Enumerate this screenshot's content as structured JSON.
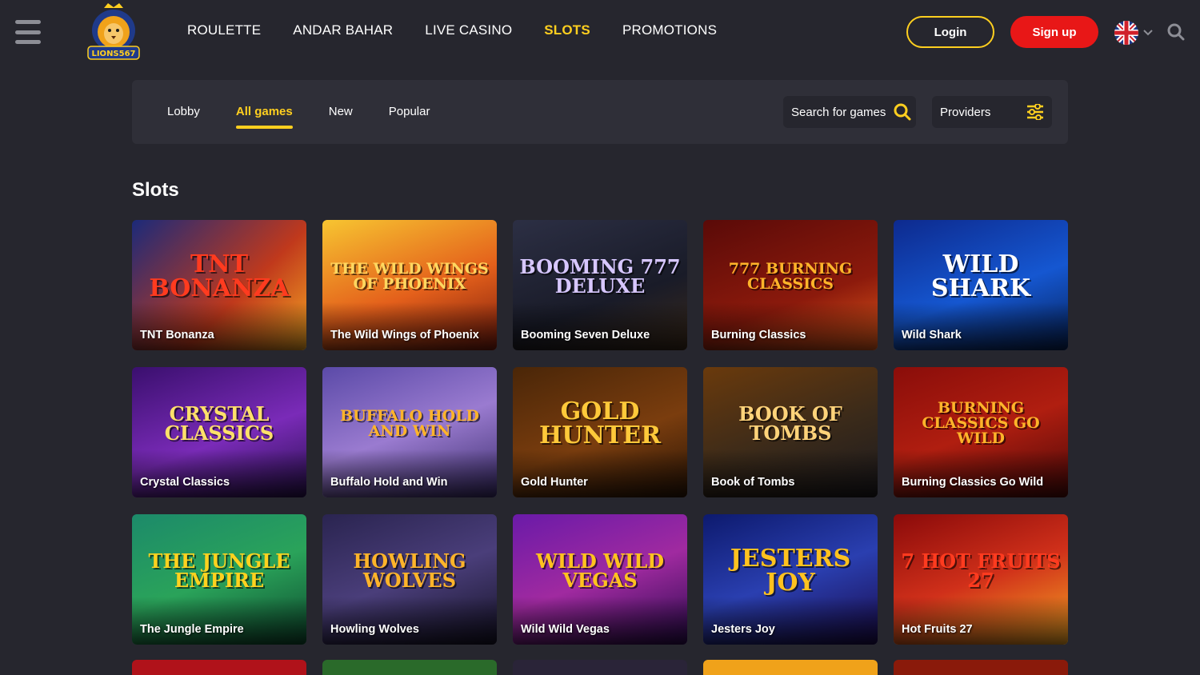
{
  "header": {
    "logo_text": "LIONS567",
    "nav": [
      {
        "label": "ROULETTE",
        "active": false
      },
      {
        "label": "ANDAR BAHAR",
        "active": false
      },
      {
        "label": "LIVE CASINO",
        "active": false
      },
      {
        "label": "SLOTS",
        "active": true
      },
      {
        "label": "PROMOTIONS",
        "active": false
      }
    ],
    "login_label": "Login",
    "signup_label": "Sign up",
    "language_icon": "uk-flag-icon"
  },
  "tabs": {
    "items": [
      {
        "label": "Lobby",
        "active": false
      },
      {
        "label": "All games",
        "active": true
      },
      {
        "label": "New",
        "active": false
      },
      {
        "label": "Popular",
        "active": false
      }
    ],
    "search_label": "Search for games",
    "providers_label": "Providers"
  },
  "section": {
    "title": "Slots"
  },
  "games": [
    {
      "title": "TNT Bonanza",
      "art": "TNT BONANZA",
      "bg": "linear-gradient(135deg,#1b2a7a,#c0391c 60%,#f5a623)",
      "color": "#ff3b1f"
    },
    {
      "title": "The Wild Wings of Phoenix",
      "art": "THE WILD WINGS OF PHOENIX",
      "bg": "linear-gradient(160deg,#f7c531,#e4601b 55%,#7a1b0c)",
      "color": "#ffd760"
    },
    {
      "title": "Booming Seven Deluxe",
      "art": "BOOMING 777 DELUXE",
      "bg": "linear-gradient(160deg,#2c2f44,#191b28 60%,#3b2a1a)",
      "color": "#d7c7ff"
    },
    {
      "title": "Burning Classics",
      "art": "777 BURNING CLASSICS",
      "bg": "linear-gradient(160deg,#5a0a08,#8c1a0c 60%,#e25b1c)",
      "color": "#ffb42a"
    },
    {
      "title": "Wild Shark",
      "art": "WILD SHARK",
      "bg": "linear-gradient(160deg,#0d2a8e,#1557d1 55%,#062157)",
      "color": "#ffffff"
    },
    {
      "title": "Crystal Classics",
      "art": "CRYSTAL CLASSICS",
      "bg": "linear-gradient(160deg,#3a0f6e,#7a2bb8 55%,#28104e)",
      "color": "#ffe06a"
    },
    {
      "title": "Buffalo Hold and Win",
      "art": "BUFFALO HOLD AND WIN",
      "bg": "linear-gradient(160deg,#5b4aa8,#9a7bd0 50%,#3a2c6b)",
      "color": "#ffb42a"
    },
    {
      "title": "Gold Hunter",
      "art": "GOLD HUNTER",
      "bg": "linear-gradient(160deg,#4a2608,#7a3d0e 55%,#2a1506)",
      "color": "#ffc93a"
    },
    {
      "title": "Book of Tombs",
      "art": "BOOK OF TOMBS",
      "bg": "linear-gradient(160deg,#6a3a0c,#3a2a1a 55%,#1c1a1e)",
      "color": "#ffd37a"
    },
    {
      "title": "Burning Classics Go Wild",
      "art": "BURNING CLASSICS GO WILD",
      "bg": "linear-gradient(160deg,#8a0d0a,#b01e10 50%,#4a0808)",
      "color": "#ffb42a"
    },
    {
      "title": "The Jungle Empire",
      "art": "THE JUNGLE EMPIRE",
      "bg": "linear-gradient(160deg,#1c8a6a,#2aa35a 50%,#0d4a2e)",
      "color": "#ffd21f"
    },
    {
      "title": "Howling Wolves",
      "art": "HOWLING WOLVES",
      "bg": "linear-gradient(160deg,#2a2450,#4a3e7a 50%,#151226)",
      "color": "#ffb42a"
    },
    {
      "title": "Wild Wild Vegas",
      "art": "WILD WILD VEGAS",
      "bg": "linear-gradient(160deg,#6a1aa8,#a02aa0 50%,#2a0a4e)",
      "color": "#ffc21f"
    },
    {
      "title": "Jesters Joy",
      "art": "JESTERS JOY",
      "bg": "linear-gradient(160deg,#0d1a6e,#2a3fb0 50%,#1a0a4a)",
      "color": "#ffc21f"
    },
    {
      "title": "Hot Fruits 27",
      "art": "7 HOT FRUITS 27",
      "bg": "linear-gradient(160deg,#8a0a0a,#d0301a 50%,#f5a623)",
      "color": "#ff3b1f"
    }
  ],
  "next_row_colors": [
    "#b0121a",
    "#2a6a2a",
    "#2a2438",
    "#f0a21a",
    "#8a1a0a"
  ]
}
